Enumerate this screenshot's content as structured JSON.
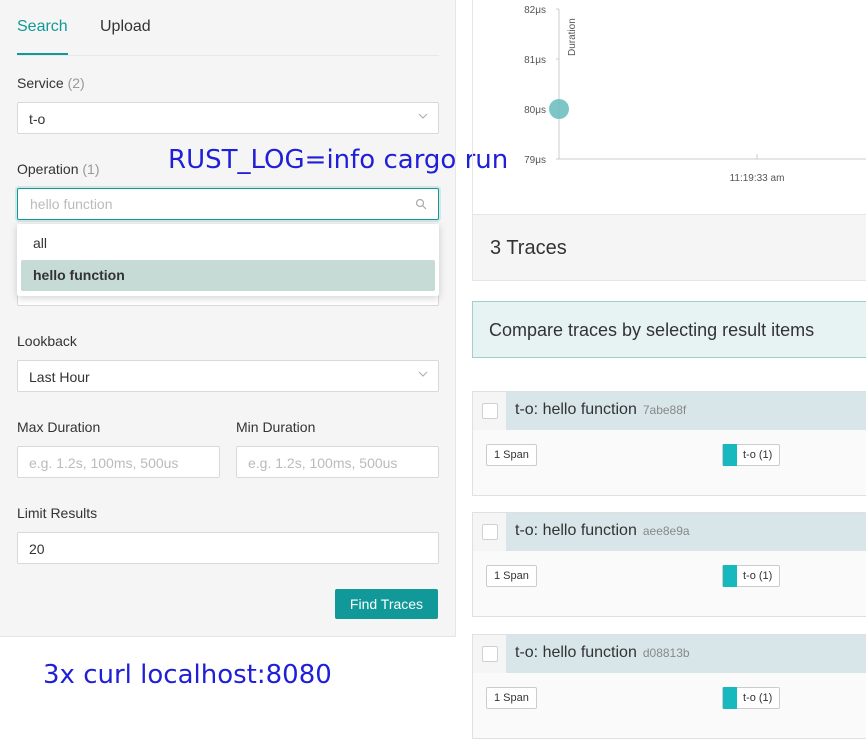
{
  "tabs": [
    {
      "label": "Search"
    },
    {
      "label": "Upload"
    }
  ],
  "form": {
    "service": {
      "label": "Service",
      "count": "(2)",
      "value": "t-o"
    },
    "operation": {
      "label": "Operation",
      "count": "(1)",
      "placeholder": "hello function",
      "options": [
        "all",
        "hello function"
      ],
      "selected": "hello function"
    },
    "lookback": {
      "label": "Lookback",
      "value": "Last Hour"
    },
    "max_duration": {
      "label": "Max Duration",
      "placeholder": "e.g. 1.2s, 100ms, 500us"
    },
    "min_duration": {
      "label": "Min Duration",
      "placeholder": "e.g. 1.2s, 100ms, 500us"
    },
    "limit": {
      "label": "Limit Results",
      "value": "20"
    },
    "find_button": "Find Traces"
  },
  "annotations": {
    "top": "RUST_LOG=info cargo run",
    "bottom": "3x curl localhost:8080"
  },
  "chart_data": {
    "type": "scatter",
    "ylabel": "Duration",
    "y_ticks": [
      "82μs",
      "81μs",
      "80μs",
      "79μs"
    ],
    "x_ticks": [
      "11:19:33 am"
    ],
    "ylim": [
      79,
      82
    ],
    "points": [
      {
        "y": 80
      }
    ],
    "point_color": "#6fbfc1"
  },
  "results": {
    "count_label": "3 Traces",
    "compare_text": "Compare traces by selecting result items",
    "traces": [
      {
        "title": "t-o: hello function",
        "id": "7abe88f",
        "spans": "1 Span",
        "service": "t-o (1)"
      },
      {
        "title": "t-o: hello function",
        "id": "aee8e9a",
        "spans": "1 Span",
        "service": "t-o (1)"
      },
      {
        "title": "t-o: hello function",
        "id": "d08813b",
        "spans": "1 Span",
        "service": "t-o (1)"
      }
    ]
  },
  "colors": {
    "accent": "#119999",
    "service": "#17b8be"
  }
}
